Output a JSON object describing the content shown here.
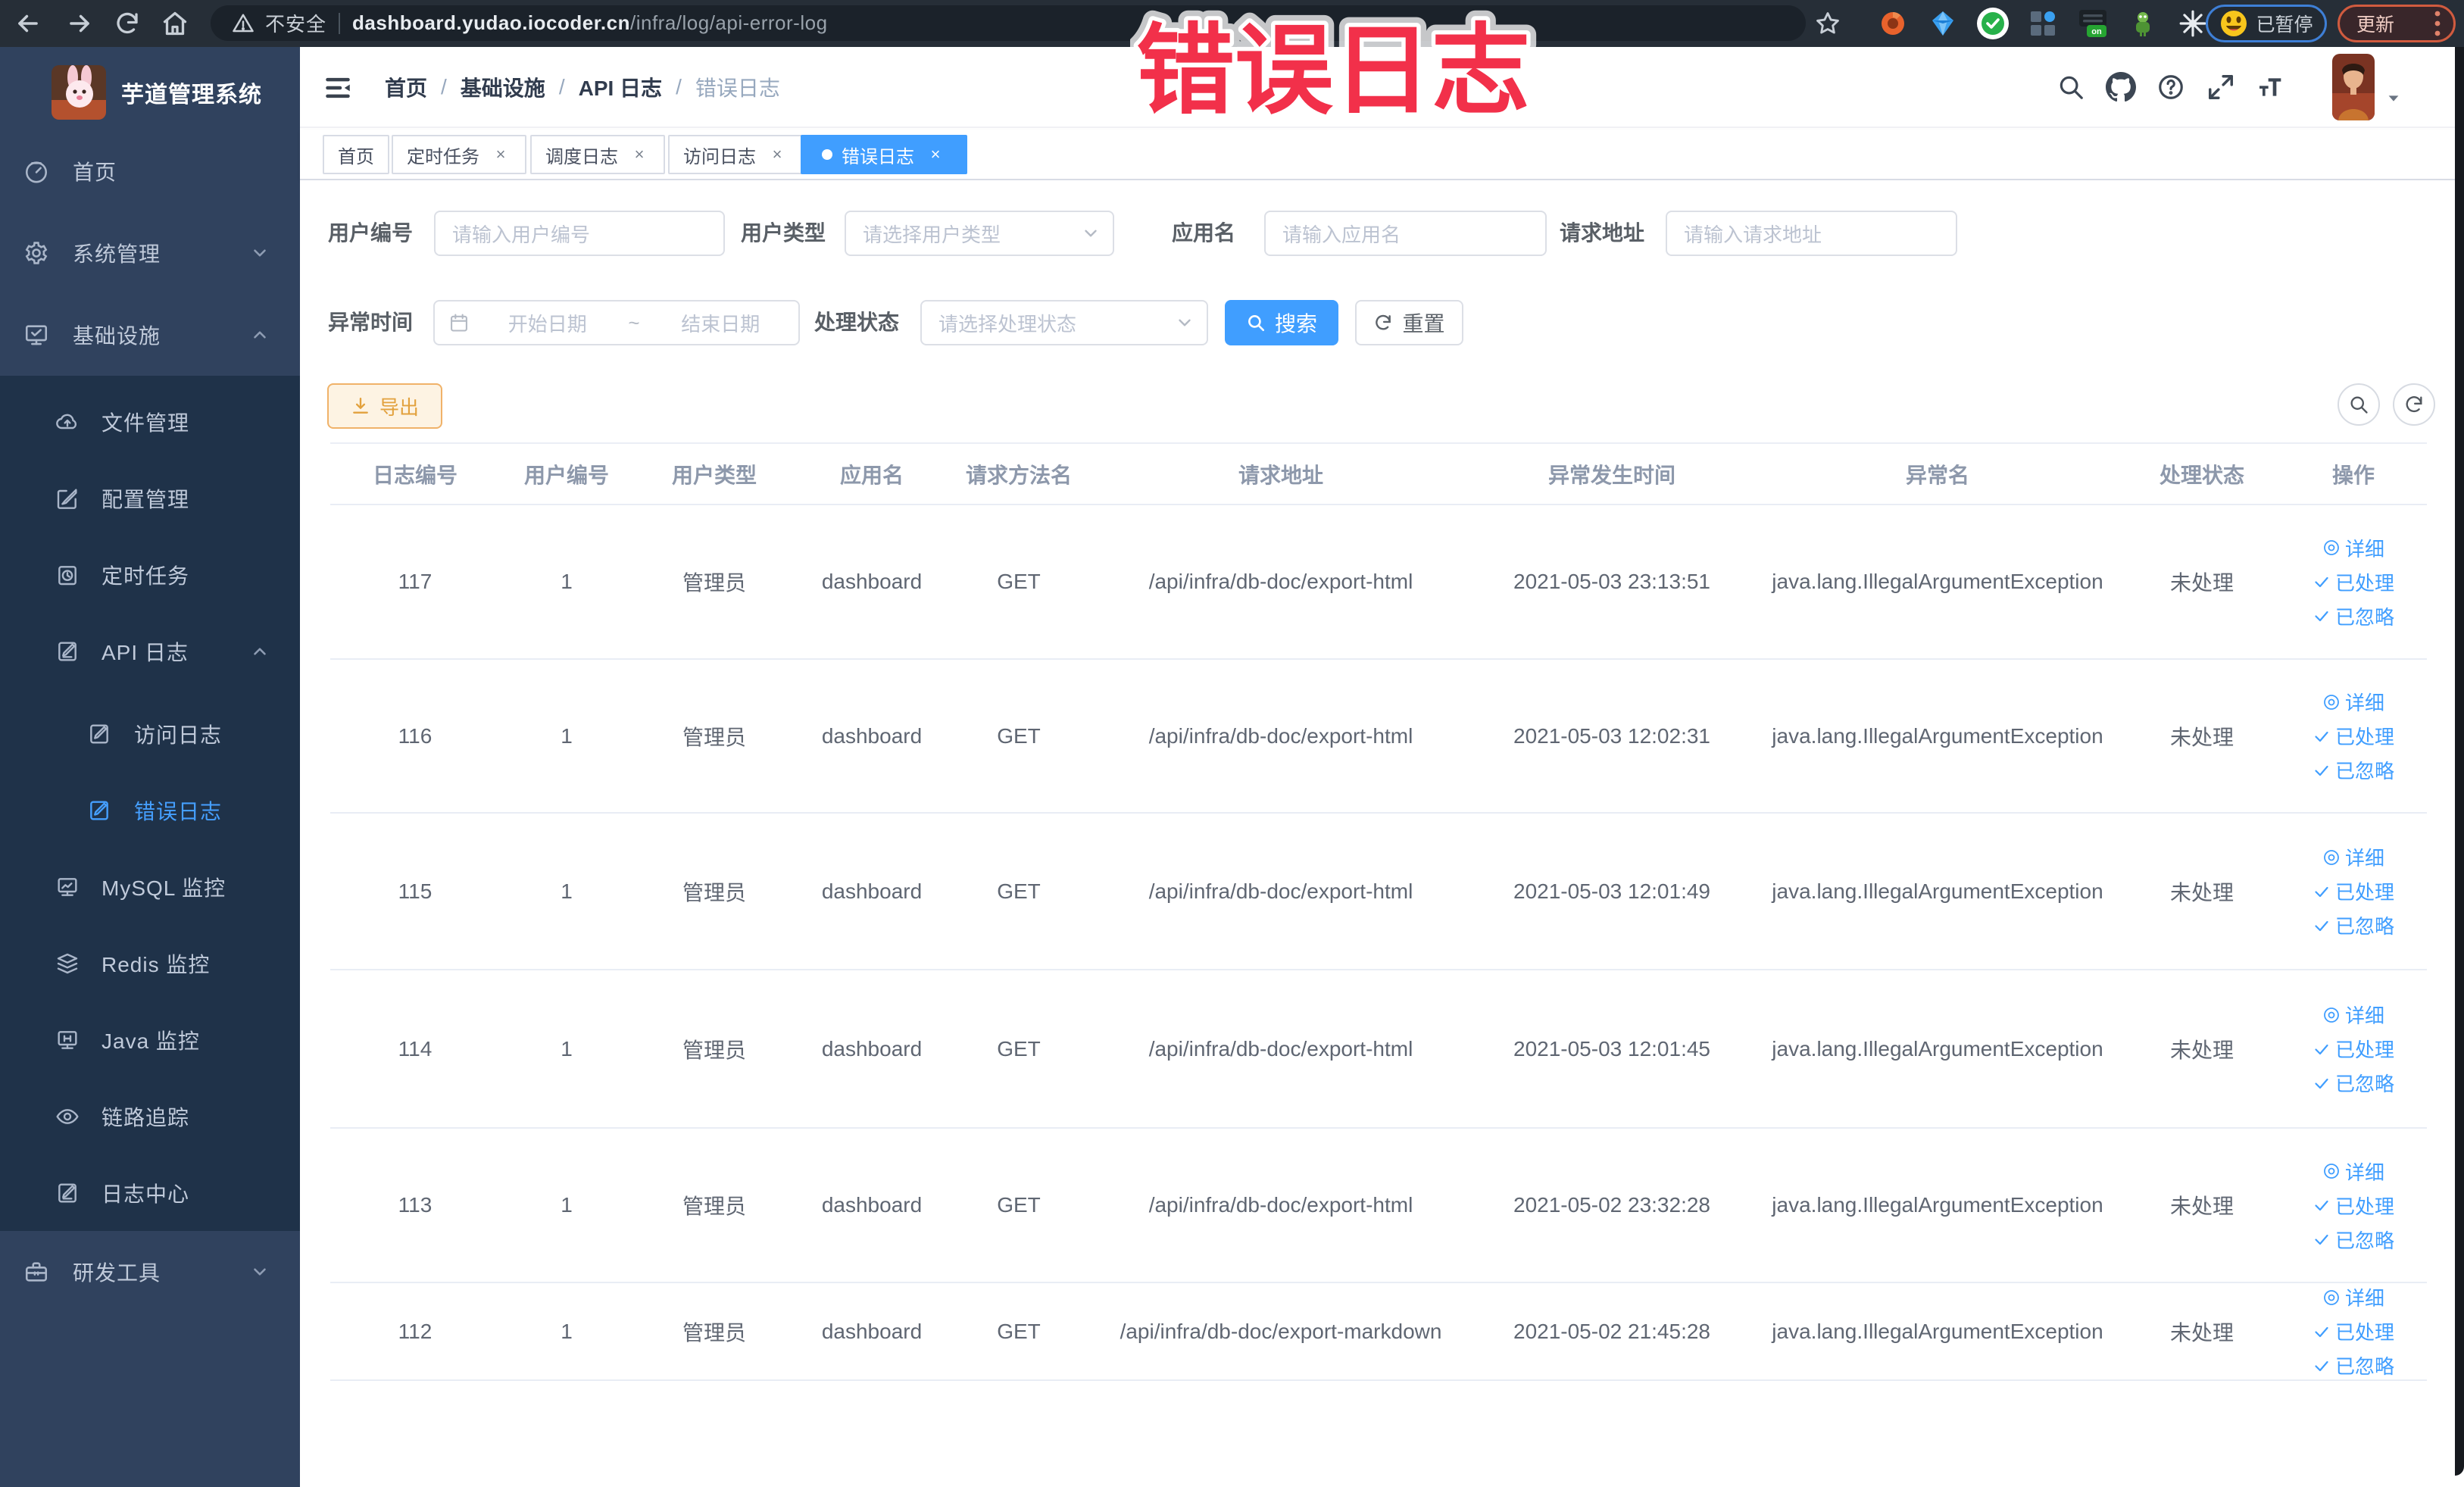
{
  "browser": {
    "security_label": "不安全",
    "url_host": "dashboard.yudao.iocoder.cn",
    "url_path": "/infra/log/api-error-log",
    "paused_badge": "已暂停",
    "update_button": "更新",
    "extension_on_badge": "on"
  },
  "annotation": {
    "stamp_text": "错误日志",
    "color": "#f2304a"
  },
  "sidebar": {
    "logo_title": "芋道管理系统",
    "items": [
      {
        "label": "首页"
      },
      {
        "label": "系统管理"
      },
      {
        "label": "基础设施"
      },
      {
        "label": "文件管理"
      },
      {
        "label": "配置管理"
      },
      {
        "label": "定时任务"
      },
      {
        "label": "API 日志"
      },
      {
        "label": "访问日志"
      },
      {
        "label": "错误日志"
      },
      {
        "label": "MySQL 监控"
      },
      {
        "label": "Redis 监控"
      },
      {
        "label": "Java 监控"
      },
      {
        "label": "链路追踪"
      },
      {
        "label": "日志中心"
      },
      {
        "label": "研发工具"
      }
    ]
  },
  "navbar": {
    "breadcrumbs": [
      "首页",
      "基础设施",
      "API 日志",
      "错误日志"
    ]
  },
  "tabs": [
    {
      "label": "首页"
    },
    {
      "label": "定时任务"
    },
    {
      "label": "调度日志"
    },
    {
      "label": "访问日志"
    },
    {
      "label": "错误日志"
    }
  ],
  "filters": {
    "user_id": {
      "label": "用户编号",
      "placeholder": "请输入用户编号"
    },
    "user_type": {
      "label": "用户类型",
      "placeholder": "请选择用户类型"
    },
    "app_name": {
      "label": "应用名",
      "placeholder": "请输入应用名"
    },
    "request_url": {
      "label": "请求地址",
      "placeholder": "请输入请求地址"
    },
    "exception_time": {
      "label": "异常时间",
      "start_placeholder": "开始日期",
      "separator": "~",
      "end_placeholder": "结束日期"
    },
    "process_status": {
      "label": "处理状态",
      "placeholder": "请选择处理状态"
    },
    "search_button": "搜索",
    "reset_button": "重置"
  },
  "toolbar": {
    "export_button": "导出"
  },
  "table": {
    "columns": [
      "日志编号",
      "用户编号",
      "用户类型",
      "应用名",
      "请求方法名",
      "请求地址",
      "异常发生时间",
      "异常名",
      "处理状态",
      "操作"
    ],
    "actions": {
      "detail": "详细",
      "processed": "已处理",
      "ignored": "已忽略"
    },
    "rows": [
      {
        "id": "117",
        "user_id": "1",
        "user_type": "管理员",
        "app": "dashboard",
        "method": "GET",
        "url": "/api/infra/db-doc/export-html",
        "time": "2021-05-03 23:13:51",
        "exception": "java.lang.IllegalArgumentException",
        "status": "未处理"
      },
      {
        "id": "116",
        "user_id": "1",
        "user_type": "管理员",
        "app": "dashboard",
        "method": "GET",
        "url": "/api/infra/db-doc/export-html",
        "time": "2021-05-03 12:02:31",
        "exception": "java.lang.IllegalArgumentException",
        "status": "未处理"
      },
      {
        "id": "115",
        "user_id": "1",
        "user_type": "管理员",
        "app": "dashboard",
        "method": "GET",
        "url": "/api/infra/db-doc/export-html",
        "time": "2021-05-03 12:01:49",
        "exception": "java.lang.IllegalArgumentException",
        "status": "未处理"
      },
      {
        "id": "114",
        "user_id": "1",
        "user_type": "管理员",
        "app": "dashboard",
        "method": "GET",
        "url": "/api/infra/db-doc/export-html",
        "time": "2021-05-03 12:01:45",
        "exception": "java.lang.IllegalArgumentException",
        "status": "未处理"
      },
      {
        "id": "113",
        "user_id": "1",
        "user_type": "管理员",
        "app": "dashboard",
        "method": "GET",
        "url": "/api/infra/db-doc/export-html",
        "time": "2021-05-02 23:32:28",
        "exception": "java.lang.IllegalArgumentException",
        "status": "未处理"
      },
      {
        "id": "112",
        "user_id": "1",
        "user_type": "管理员",
        "app": "dashboard",
        "method": "GET",
        "url": "/api/infra/db-doc/export-markdown",
        "time": "2021-05-02 21:45:28",
        "exception": "java.lang.IllegalArgumentException",
        "status": "未处理"
      }
    ]
  },
  "colors": {
    "primary": "#409eff",
    "warning": "#e6a23c",
    "stamp_red": "#f2304a",
    "sidebar_bg": "#30425e",
    "submenu_bg": "#1f3249"
  }
}
